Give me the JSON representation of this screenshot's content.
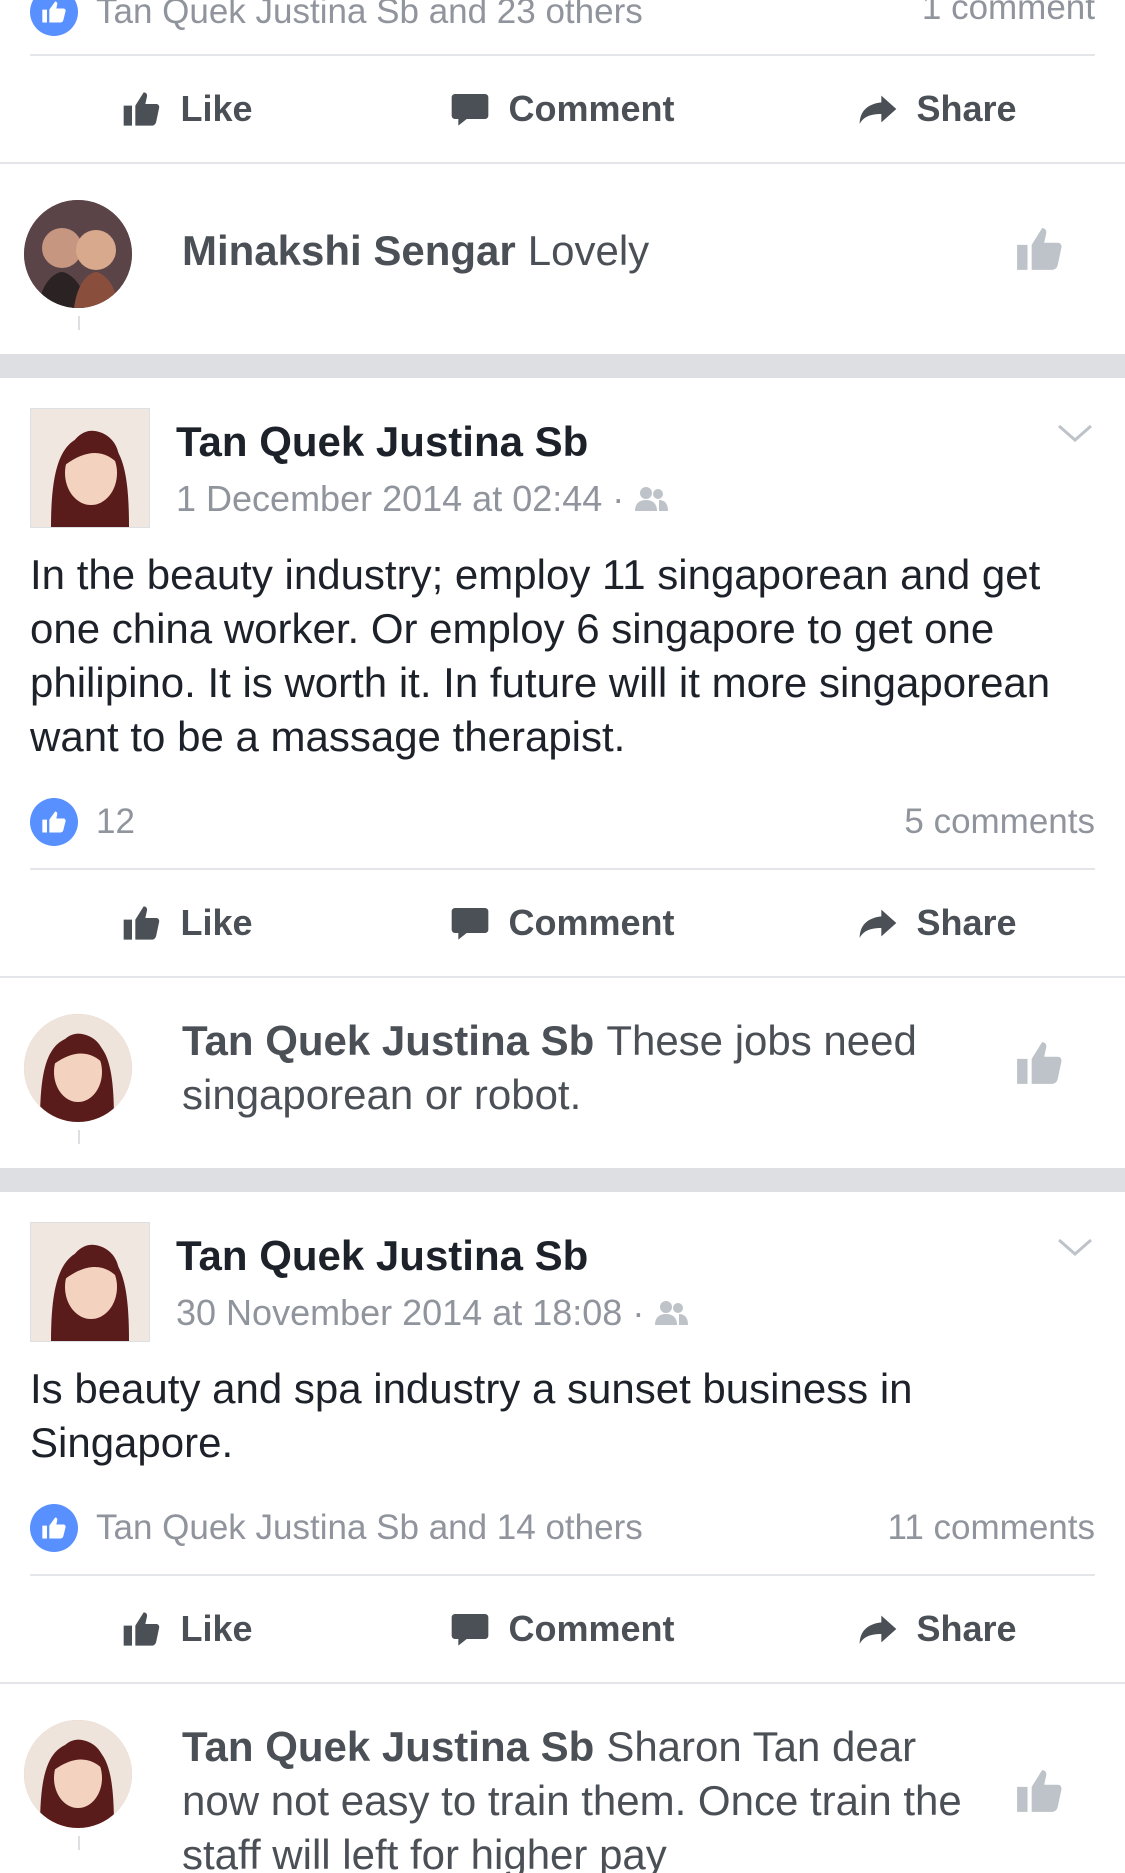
{
  "top_stats": {
    "likes": "Tan Quek Justina Sb and 23 others",
    "comments": "1 comment"
  },
  "actions": {
    "like": "Like",
    "comment": "Comment",
    "share": "Share"
  },
  "comment1": {
    "name": "Minakshi Sengar",
    "text": "Lovely"
  },
  "post1": {
    "author": "Tan Quek Justina Sb",
    "timestamp": "1 December 2014 at 02:44",
    "separator": "·",
    "body": "In the beauty industry; employ 11 singaporean and get one china worker. Or employ 6 singapore to get one philipino. It is worth it. In future will it more singaporean want to be a massage therapist.",
    "likes": "12",
    "comments": "5 comments"
  },
  "comment2": {
    "name": "Tan Quek Justina Sb",
    "text": "These jobs need singaporean or robot."
  },
  "post2": {
    "author": "Tan Quek Justina Sb",
    "timestamp": "30 November 2014 at 18:08",
    "separator": "·",
    "body": "Is beauty and spa industry a sunset business in Singapore.",
    "likes": "Tan Quek Justina Sb and 14 others",
    "comments": "11 comments"
  },
  "comment3": {
    "name": "Tan Quek Justina Sb",
    "text": "Sharon Tan dear now not easy to train them. Once train the staff will left for higher pay"
  },
  "icons": {
    "like_badge": "thumbs-up-icon",
    "like_action": "thumbs-up-icon",
    "comment_action": "speech-bubble-icon",
    "share_action": "share-arrow-icon",
    "privacy": "friends-icon",
    "menu": "chevron-down-icon"
  },
  "colors": {
    "accent": "#5890ff",
    "text": "#1d2129",
    "muted": "#90949c",
    "action": "#4b4f56"
  }
}
